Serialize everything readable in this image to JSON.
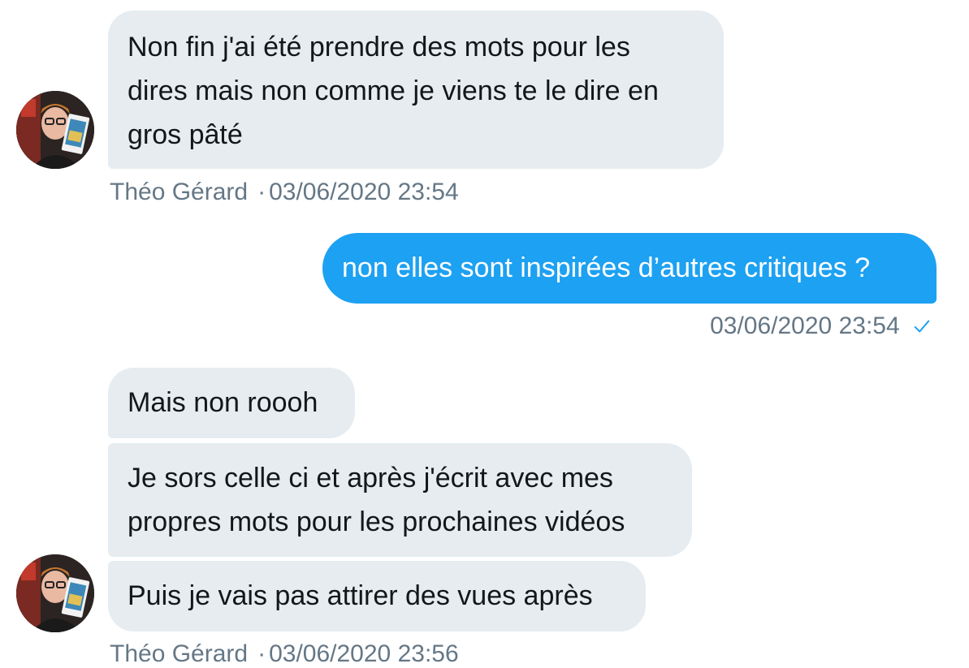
{
  "messages": [
    {
      "from": "them",
      "lines": [
        "Non fin j'ai été prendre des mots pour les",
        "dires mais non comme je viens te le dire en",
        "gros pâté"
      ]
    },
    {
      "from": "me",
      "lines": [
        "non elles sont inspirées d’autres critiques ?"
      ]
    },
    {
      "from": "them",
      "lines": [
        "Mais non roooh"
      ]
    },
    {
      "from": "them",
      "lines": [
        "Je sors celle ci et après j'écrit avec mes",
        "propres mots pour les prochaines vidéos"
      ]
    },
    {
      "from": "them",
      "lines": [
        "Puis je vais pas attirer des vues après"
      ]
    }
  ],
  "meta": [
    {
      "sender": "Théo Gérard",
      "separator": "·",
      "time": "03/06/2020 23:54"
    },
    {
      "time": "03/06/2020 23:54",
      "status_icon": "checkmark-icon"
    },
    {
      "sender": "Théo Gérard",
      "separator": "·",
      "time": "03/06/2020 23:56"
    }
  ],
  "colors": {
    "incoming_bubble": "#e6ecf0",
    "outgoing_bubble": "#1da1f2",
    "meta_text": "#657786",
    "check": "#1da1f2"
  }
}
